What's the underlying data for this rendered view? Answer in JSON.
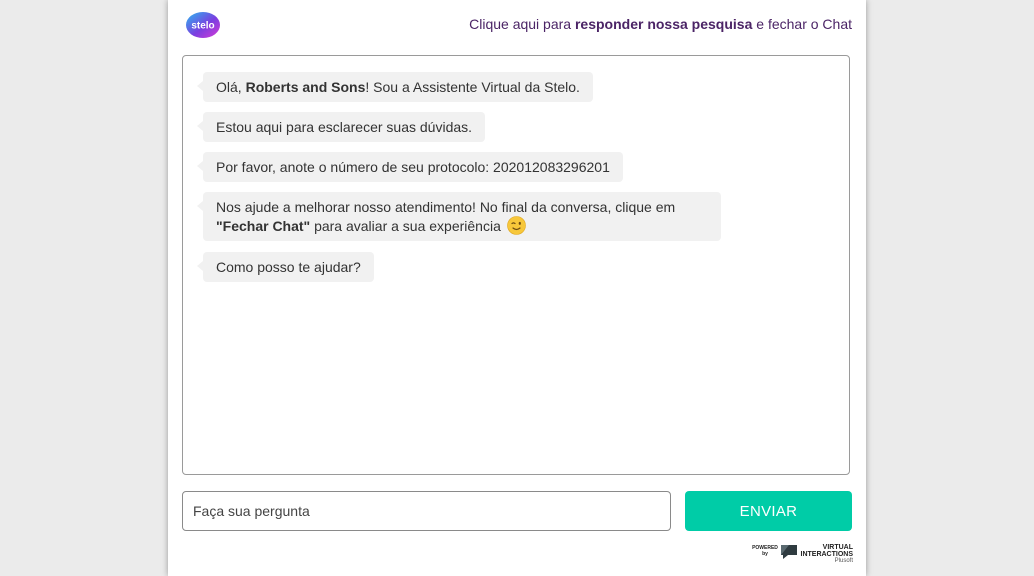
{
  "header": {
    "logo_text": "stelo",
    "survey_prefix": "Clique aqui para ",
    "survey_link": "responder nossa pesquisa",
    "survey_suffix": " e fechar o Chat"
  },
  "messages": [
    {
      "pre": "Olá, ",
      "bold": "Roberts and Sons",
      "post": "! Sou a Assistente Virtual da Stelo."
    },
    {
      "text": "Estou aqui para esclarecer suas dúvidas."
    },
    {
      "text": "Por favor, anote o número de seu protocolo: 202012083296201"
    },
    {
      "pre": "Nos ajude a melhorar nosso atendimento! No final da conversa, clique em ",
      "bold": "\"Fechar Chat\"",
      "post": " para avaliar a sua experiência",
      "emoji": "winking-face-icon"
    },
    {
      "text": "Como posso te ajudar?"
    }
  ],
  "input": {
    "placeholder": "Faça sua pergunta",
    "value": ""
  },
  "send_button": {
    "label": "ENVIAR"
  },
  "footer": {
    "powered_by": "POWERED by",
    "brand_line1": "VIRTUAL",
    "brand_line2": "INTERACTIONS",
    "brand_line3": "Plusoft"
  },
  "colors": {
    "accent": "#00cca7",
    "header_text": "#4b2466",
    "bubble_bg": "#f1f1f1"
  }
}
